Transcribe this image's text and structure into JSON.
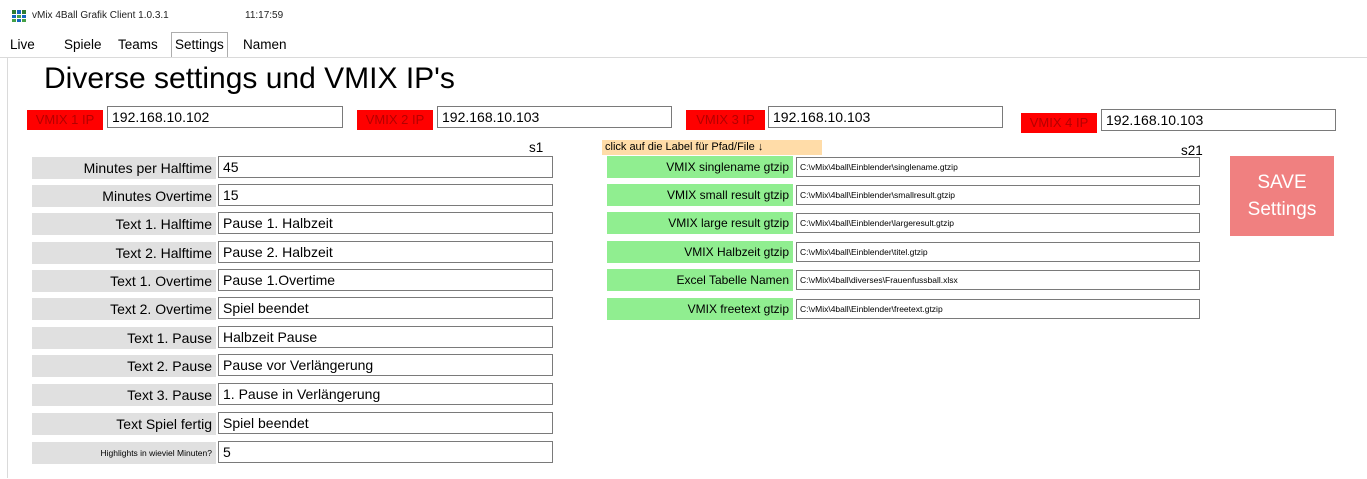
{
  "window": {
    "title": "vMix 4Ball Grafik Client 1.0.3.1",
    "clock": "11:17:59",
    "icon": "vmix-app-icon"
  },
  "tabs": [
    {
      "label": "Live",
      "active": false
    },
    {
      "label": "Spiele",
      "active": false
    },
    {
      "label": "Teams",
      "active": false
    },
    {
      "label": "Settings",
      "active": true
    },
    {
      "label": "Namen",
      "active": false
    }
  ],
  "page": {
    "title": "Diverse settings und VMIX IP's"
  },
  "vmix_ips": [
    {
      "label": "VMIX 1 IP",
      "value": "192.168.10.102"
    },
    {
      "label": "VMIX 2 IP",
      "value": "192.168.10.103"
    },
    {
      "label": "VMIX 3 IP",
      "value": "192.168.10.103"
    },
    {
      "label": "VMIX 4 IP",
      "value": "192.168.10.103"
    }
  ],
  "column_tags": {
    "s1": "s1",
    "s21": "s21"
  },
  "settings": [
    {
      "label": "Minutes per Halftime",
      "value": "45"
    },
    {
      "label": "Minutes Overtime",
      "value": "15"
    },
    {
      "label": "Text 1. Halftime",
      "value": "Pause 1. Halbzeit"
    },
    {
      "label": "Text 2. Halftime",
      "value": "Pause 2. Halbzeit"
    },
    {
      "label": "Text 1. Overtime",
      "value": "Pause 1.Overtime"
    },
    {
      "label": "Text 2. Overtime",
      "value": "Spiel beendet"
    },
    {
      "label": "Text 1. Pause",
      "value": "Halbzeit Pause"
    },
    {
      "label": "Text 2. Pause",
      "value": "Pause vor Verlängerung"
    },
    {
      "label": "Text 3. Pause",
      "value": "1. Pause in Verlängerung"
    },
    {
      "label": "Text Spiel fertig",
      "value": "Spiel beendet"
    },
    {
      "label": "Highlights in wieviel Minuten?",
      "value": "5"
    }
  ],
  "files": {
    "hint": "click auf die Label für Pfad/File ↓",
    "items": [
      {
        "label": "VMIX singlename gtzip",
        "value": "C:\\vMix\\4ball\\Einblender\\singlename.gtzip"
      },
      {
        "label": "VMIX small result gtzip",
        "value": "C:\\vMix\\4ball\\Einblender\\smallresult.gtzip"
      },
      {
        "label": "VMIX large result gtzip",
        "value": "C:\\vMix\\4ball\\Einblender\\largeresult.gtzip"
      },
      {
        "label": "VMIX Halbzeit gtzip",
        "value": "C:\\vMix\\4ball\\Einblender\\titel.gtzip"
      },
      {
        "label": "Excel Tabelle Namen",
        "value": "C:\\vMix\\4ball\\diverses\\Frauenfussball.xlsx"
      },
      {
        "label": "VMIX freetext gtzip",
        "value": "C:\\vMix\\4ball\\Einblender\\freetext.gtzip"
      }
    ]
  },
  "save_button": {
    "line1": "SAVE",
    "line2": "Settings"
  },
  "colors": {
    "ip_label_bg": "#ff0000",
    "file_label_bg": "#90ee90",
    "setting_label_bg": "#e0e0e0",
    "hint_bg": "#ffdca8",
    "save_bg": "#f08080"
  }
}
